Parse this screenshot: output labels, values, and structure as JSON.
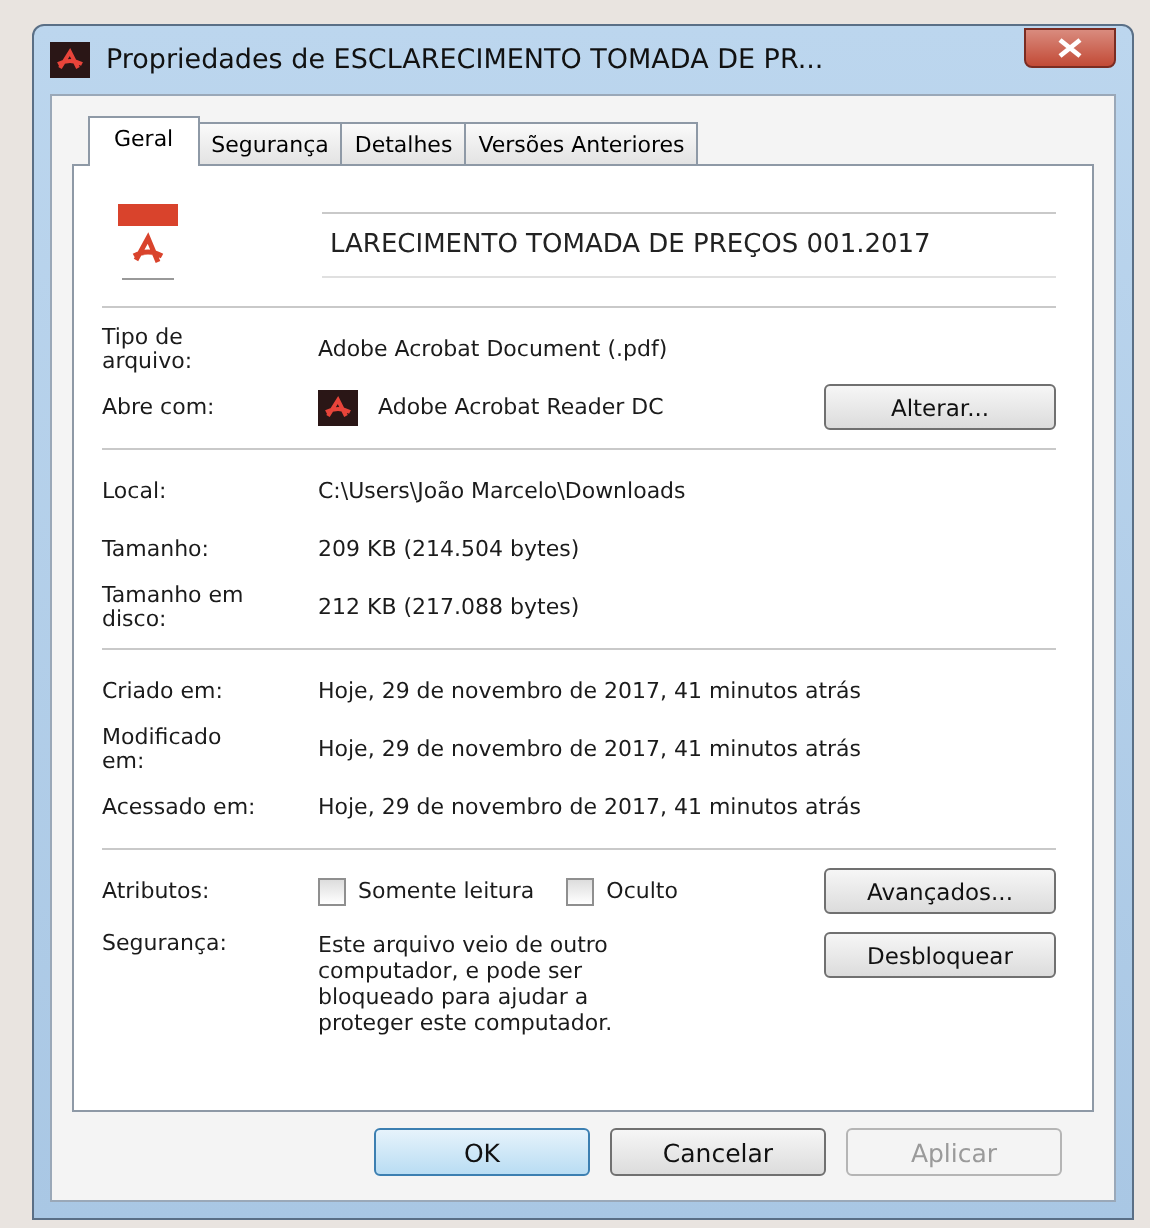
{
  "window": {
    "title": "Propriedades de ESCLARECIMENTO TOMADA DE PR..."
  },
  "tabs": [
    {
      "label": "Geral",
      "selected": true
    },
    {
      "label": "Segurança",
      "selected": false
    },
    {
      "label": "Detalhes",
      "selected": false
    },
    {
      "label": "Versões Anteriores",
      "selected": false
    }
  ],
  "file_name": {
    "value": "LARECIMENTO TOMADA DE PREÇOS 001.2017"
  },
  "sections": [
    {
      "rows": [
        {
          "label": "Tipo de arquivo:",
          "value": "Adobe Acrobat Document (.pdf)"
        },
        {
          "label": "Abre com:",
          "value": "Adobe Acrobat Reader DC",
          "kind": "app",
          "button": "Alterar..."
        }
      ]
    },
    {
      "rows": [
        {
          "label": "Local:",
          "value": "C:\\Users\\João Marcelo\\Downloads"
        },
        {
          "label": "Tamanho:",
          "value": "209 KB (214.504 bytes)"
        },
        {
          "label": "Tamanho em disco:",
          "value": "212 KB (217.088 bytes)"
        }
      ]
    },
    {
      "rows": [
        {
          "label": "Criado em:",
          "value": "Hoje, 29 de novembro de 2017, 41 minutos atrás"
        },
        {
          "label": "Modificado em:",
          "value": "Hoje, 29 de novembro de 2017, 41 minutos atrás"
        },
        {
          "label": "Acessado em:",
          "value": "Hoje, 29 de novembro de 2017, 41 minutos atrás"
        }
      ]
    }
  ],
  "attributes": {
    "label": "Atributos:",
    "checkboxes": [
      {
        "label": "Somente leitura",
        "checked": false
      },
      {
        "label": "Oculto",
        "checked": false
      }
    ],
    "button": "Avançados..."
  },
  "security": {
    "label": "Segurança:",
    "text": "Este arquivo veio de outro computador, e pode ser bloqueado para ajudar a proteger este computador.",
    "button": "Desbloquear"
  },
  "buttons": [
    {
      "label": "OK",
      "disabled": false,
      "default": true
    },
    {
      "label": "Cancelar",
      "disabled": false,
      "default": false
    },
    {
      "label": "Aplicar",
      "disabled": true,
      "default": false
    }
  ]
}
